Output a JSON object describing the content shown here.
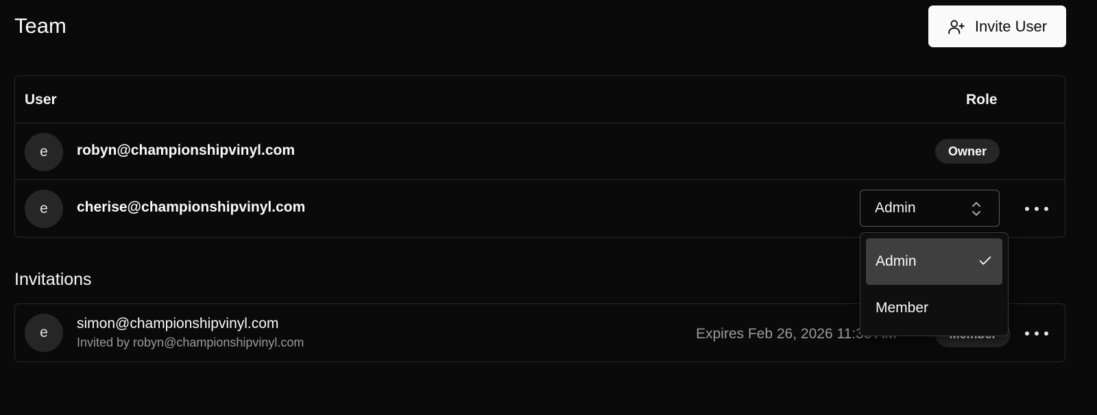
{
  "page": {
    "title": "Team"
  },
  "invite_button": {
    "label": "Invite User",
    "icon": "user-plus-icon"
  },
  "team_table": {
    "headers": {
      "user": "User",
      "role": "Role"
    },
    "rows": [
      {
        "avatar": "e",
        "email": "robyn@championshipvinyl.com",
        "role": "Owner"
      },
      {
        "avatar": "e",
        "email": "cherise@championshipvinyl.com",
        "role": "Admin"
      }
    ]
  },
  "invitations": {
    "title": "Invitations",
    "items": [
      {
        "avatar": "e",
        "email": "simon@championshipvinyl.com",
        "invited_by": "Invited by robyn@championshipvinyl.com",
        "expires": "Expires Feb 26, 2026 11:33 AM",
        "role": "Member"
      }
    ]
  },
  "role_dropdown": {
    "options": [
      {
        "label": "Admin",
        "selected": true
      },
      {
        "label": "Member",
        "selected": false
      }
    ]
  },
  "colors": {
    "background": "#0a0a0a",
    "border": "#2a2a2a",
    "badge": "#262626",
    "button": "#fafafa"
  }
}
